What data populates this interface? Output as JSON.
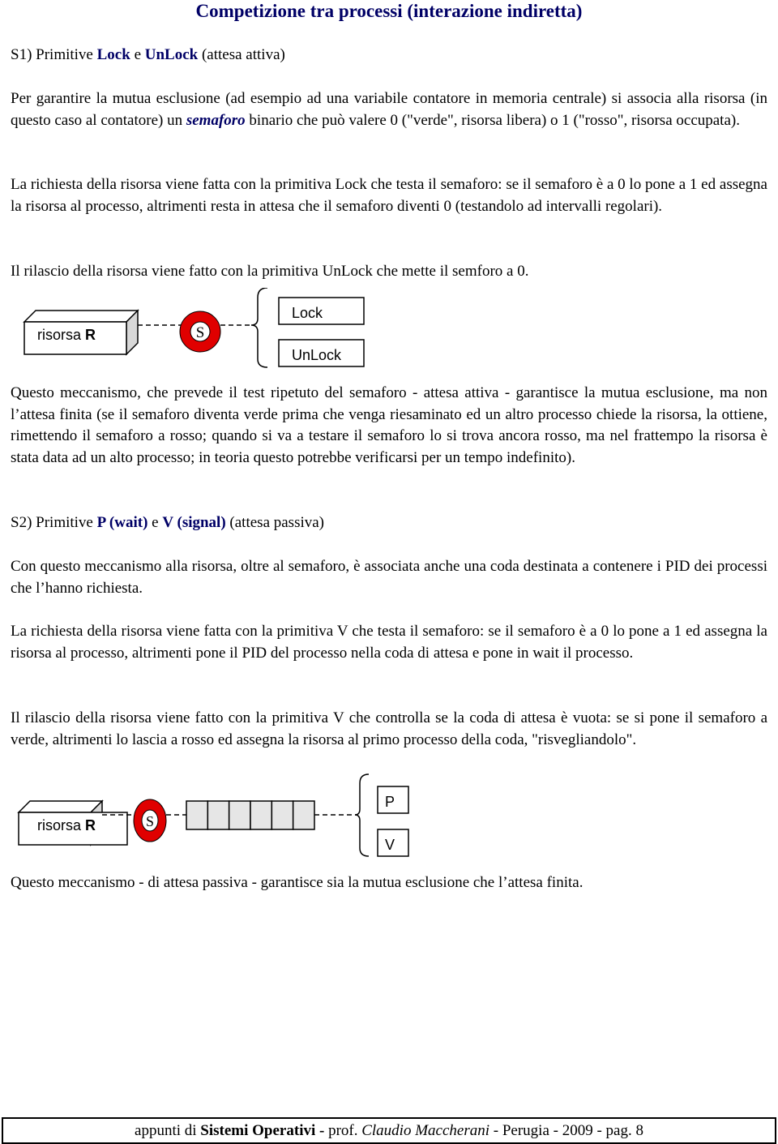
{
  "title": "Competizione tra processi (interazione indiretta)",
  "s1": {
    "prefix": "S1) Primitive ",
    "lock": "Lock",
    "e": " e ",
    "unlock": "UnLock",
    "suffix": " (attesa attiva)"
  },
  "para1": {
    "a": "Per garantire la mutua esclusione (ad esempio ad una variabile contatore in memoria centrale) si associa alla risorsa (in questo caso al contatore) un ",
    "em": "semaforo",
    "b": " binario che può valere 0 (\"verde\", risorsa libera) o 1 (\"rosso\", risorsa occupata)."
  },
  "para2": "La richiesta della risorsa viene fatta con la primitiva Lock che testa il semaforo: se il semaforo è a 0 lo pone a 1 ed assegna la risorsa al processo, altrimenti resta in attesa che il semaforo diventi 0 (testandolo ad intervalli regolari).",
  "para3": "Il rilascio della risorsa viene fatto con la primitiva UnLock che mette il semforo a 0.",
  "diagram1": {
    "resource_label": "risorsa ",
    "resource_bold": "R",
    "semaphore": "S",
    "ops": [
      "Lock",
      "UnLock"
    ]
  },
  "para4": "Questo meccanismo, che prevede il test ripetuto del semaforo - attesa attiva - garantisce la mutua esclusione, ma non l’attesa finita (se il semaforo diventa verde prima che venga riesaminato ed un altro processo chiede la risorsa, la ottiene, rimettendo il semaforo a rosso; quando si va a testare il semaforo lo si trova ancora rosso, ma nel frattempo la risorsa è stata data ad un alto processo; in teoria questo potrebbe verificarsi per un tempo indefinito).",
  "s2": {
    "prefix": "S2) Primitive ",
    "p": "P (wait)",
    "e": " e ",
    "v": "V (signal)",
    "suffix": " (attesa passiva)"
  },
  "para5": "Con questo meccanismo alla risorsa, oltre al semaforo, è associata anche una coda destinata a contenere i PID dei processi che l’hanno richiesta.",
  "para6": "La richiesta della risorsa viene fatta con la primitiva V che testa il semaforo: se il semaforo è a 0 lo pone a 1 ed assegna la risorsa al processo, altrimenti pone il PID del processo nella coda di attesa e pone in wait il processo.",
  "para7": "Il rilascio della risorsa viene fatto con la primitiva V che controlla se la coda di attesa è vuota: se si pone il semaforo a verde, altrimenti lo lascia a rosso ed assegna la risorsa al primo processo della coda, \"risvegliandolo\".",
  "diagram2": {
    "resource_label": "risorsa ",
    "resource_bold": "R",
    "semaphore": "S",
    "queue_slots": 6,
    "ops": [
      "P",
      "V"
    ]
  },
  "para8": "Questo meccanismo - di attesa passiva - garantisce sia la mutua esclusione che l’attesa finita.",
  "footer": {
    "a": "appunti di ",
    "course": "Sistemi Operativi -",
    "b": " prof. ",
    "author": "Claudio Maccherani",
    "c": " - Perugia - 2009 - pag. 8"
  },
  "colors": {
    "accent": "#000066",
    "semaphore": "#e00000"
  }
}
